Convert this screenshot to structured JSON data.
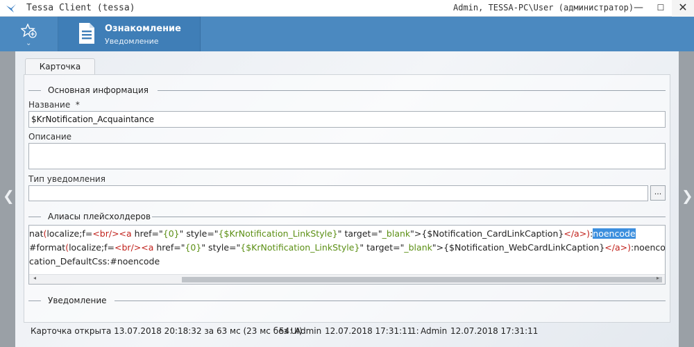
{
  "window": {
    "title": "Tessa Client (tessa)",
    "user": "Admin, TESSA-PC\\User (администратор)",
    "minimize": "—",
    "maximize": "☐",
    "close": "✕"
  },
  "header": {
    "favorites_chevron": "⌄",
    "tab_title": "Ознакомление",
    "tab_subtitle": "Уведомление",
    "accent": "#4b89c0"
  },
  "card_tab": "Карточка",
  "sections": {
    "main_info": "Основная информация",
    "aliases": "Алиасы плейсхолдеров",
    "notification": "Уведомление"
  },
  "fields": {
    "name_label": "Название",
    "name_required": "*",
    "name_value": "$KrNotification_Acquaintance",
    "description_label": "Описание",
    "description_value": "",
    "type_label": "Тип уведомления",
    "type_value": "",
    "browse_label": "..."
  },
  "code_lines": {
    "l1": {
      "p1": "nat",
      "p2": "(",
      "p3": "localize;f=",
      "p4": "<br/><a",
      "p5": " href=\"",
      "p6": "{0}",
      "p7": "\" style=\"",
      "p8": "{$KrNotification_LinkStyle}",
      "p9": "\" target=\"",
      "p10": "_blank",
      "p11": "\">",
      "p12": "{$Notification_CardLinkCaption}",
      "p13": "</a>",
      "p14": ")",
      "p15": ":",
      "p16": "noencode"
    },
    "l2": {
      "p1": "#format",
      "p2": "(",
      "p3": "localize;f=",
      "p4": "<br/><a",
      "p5": " href=\"",
      "p6": "{0}",
      "p7": "\" style=\"",
      "p8": "{$KrNotification_LinkStyle}",
      "p9": "\" target=\"",
      "p10": "_blank",
      "p11": "\">",
      "p12": "{$Notification_WebCardLinkCaption}",
      "p13": "</a>",
      "p14": ")",
      "p15": ":noencode"
    },
    "l3": "cation_DefaultCss:#noencode"
  },
  "scroll": {
    "left": "◂",
    "right": "▸"
  },
  "status": {
    "opened": "Карточка открыта 13.07.2018 20:18:32 за 63 мс (23 мс без UI)",
    "version": "54:",
    "version_user": "Admin",
    "version_date": "12.07.2018 17:31:11",
    "created": "1:",
    "created_user": "Admin",
    "created_date": "12.07.2018 17:31:11"
  },
  "nav": {
    "left_arrow": "❮",
    "right_arrow": "❯"
  }
}
